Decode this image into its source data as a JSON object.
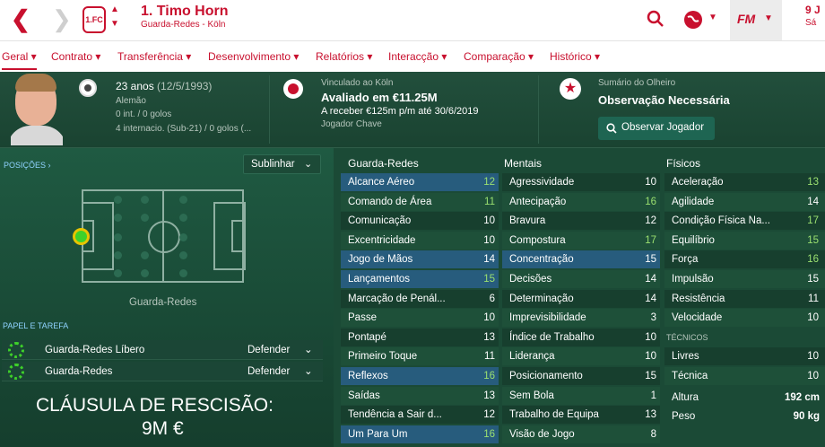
{
  "header": {
    "player_name": "1. Timo Horn",
    "player_sub": "Guarda-Redes - Köln",
    "date_partial_1": "9 J",
    "date_partial_2": "Sá",
    "fm_label": "FM"
  },
  "tabs": [
    {
      "label": "Geral"
    },
    {
      "label": "Contrato"
    },
    {
      "label": "Transferência"
    },
    {
      "label": "Desenvolvimento"
    },
    {
      "label": "Relatórios"
    },
    {
      "label": "Interacção"
    },
    {
      "label": "Comparação"
    },
    {
      "label": "Histórico"
    }
  ],
  "info": {
    "age": "23 anos",
    "dob": "(12/5/1993)",
    "nationality": "Alemão",
    "caps": "0 int. / 0 golos",
    "youth_caps": "4 internacio. (Sub-21) / 0 golos (...",
    "club_label": "Vinculado ao Köln",
    "value": "Avaliado em €11.25M",
    "wage": "A receber €125m p/m até 30/6/2019",
    "status": "Jogador Chave",
    "scout_label": "Sumário do Olheiro",
    "scout_value": "Observação Necessária",
    "scout_button": "Observar Jogador"
  },
  "positions": {
    "label": "POSIÇÕES ›",
    "view": "Sublinhar",
    "position_name": "Guarda-Redes"
  },
  "roles": {
    "label": "PAPEL E TAREFA",
    "items": [
      {
        "role": "Guarda-Redes Líbero",
        "duty": "Defender"
      },
      {
        "role": "Guarda-Redes",
        "duty": "Defender"
      }
    ]
  },
  "release_clause": {
    "line1": "CLÁUSULA DE RESCISÃO:",
    "line2": "9M €"
  },
  "attributes": {
    "gk_title": "Guarda-Redes",
    "gk": [
      {
        "name": "Alcance Aéreo",
        "value": "12"
      },
      {
        "name": "Comando de Área",
        "value": "11"
      },
      {
        "name": "Comunicação",
        "value": "10"
      },
      {
        "name": "Excentricidade",
        "value": "10"
      },
      {
        "name": "Jogo de Mãos",
        "value": "14"
      },
      {
        "name": "Lançamentos",
        "value": "15"
      },
      {
        "name": "Marcação de Penál...",
        "value": "6"
      },
      {
        "name": "Passe",
        "value": "10"
      },
      {
        "name": "Pontapé",
        "value": "13"
      },
      {
        "name": "Primeiro Toque",
        "value": "11"
      },
      {
        "name": "Reflexos",
        "value": "16"
      },
      {
        "name": "Saídas",
        "value": "13"
      },
      {
        "name": "Tendência a Sair d...",
        "value": "12"
      },
      {
        "name": "Um Para Um",
        "value": "16"
      }
    ],
    "mental_title": "Mentais",
    "mental": [
      {
        "name": "Agressividade",
        "value": "10"
      },
      {
        "name": "Antecipação",
        "value": "16"
      },
      {
        "name": "Bravura",
        "value": "12"
      },
      {
        "name": "Compostura",
        "value": "17"
      },
      {
        "name": "Concentração",
        "value": "15"
      },
      {
        "name": "Decisões",
        "value": "14"
      },
      {
        "name": "Determinação",
        "value": "14"
      },
      {
        "name": "Imprevisibilidade",
        "value": "3"
      },
      {
        "name": "Índice de Trabalho",
        "value": "10"
      },
      {
        "name": "Liderança",
        "value": "10"
      },
      {
        "name": "Posicionamento",
        "value": "15"
      },
      {
        "name": "Sem Bola",
        "value": "1"
      },
      {
        "name": "Trabalho de Equipa",
        "value": "13"
      },
      {
        "name": "Visão de Jogo",
        "value": "8"
      }
    ],
    "physical_title": "Físicos",
    "physical": [
      {
        "name": "Aceleração",
        "value": "13"
      },
      {
        "name": "Agilidade",
        "value": "14"
      },
      {
        "name": "Condição Física Na...",
        "value": "17"
      },
      {
        "name": "Equilíbrio",
        "value": "15"
      },
      {
        "name": "Força",
        "value": "16"
      },
      {
        "name": "Impulsão",
        "value": "15"
      },
      {
        "name": "Resistência",
        "value": "11"
      },
      {
        "name": "Velocidade",
        "value": "10"
      }
    ],
    "technical_title": "TÉCNICOS",
    "technical": [
      {
        "name": "Livres",
        "value": "10"
      },
      {
        "name": "Técnica",
        "value": "10"
      }
    ],
    "height_label": "Altura",
    "height": "192 cm",
    "weight_label": "Peso",
    "weight": "90 kg"
  }
}
